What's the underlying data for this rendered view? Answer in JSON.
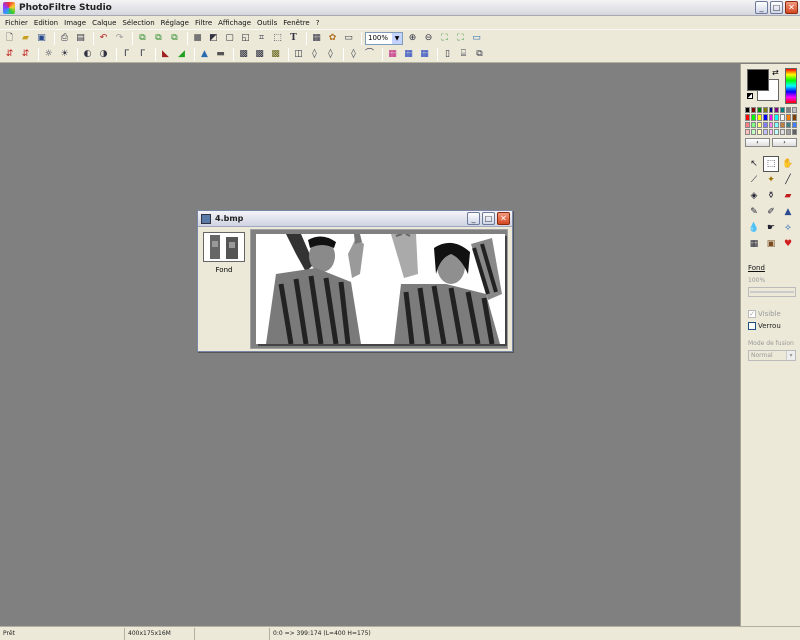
{
  "app": {
    "title": "PhotoFiltre Studio"
  },
  "window_controls": {
    "minimize": "_",
    "maximize": "□",
    "close": "✕"
  },
  "menu": [
    "Fichier",
    "Edition",
    "Image",
    "Calque",
    "Sélection",
    "Réglage",
    "Filtre",
    "Affichage",
    "Outils",
    "Fenêtre",
    "?"
  ],
  "toolbar": {
    "zoom": "100%"
  },
  "document": {
    "title": "4.bmp",
    "layer_name": "Fond"
  },
  "layer_panel": {
    "name": "Fond",
    "opacity": "100%",
    "visible_label": "Visible",
    "lock_label": "Verrou",
    "blend_label": "Mode de fusion",
    "blend_value": "Normal"
  },
  "colors": {
    "foreground": "#000000",
    "background": "#ffffff",
    "palette": [
      "#000000",
      "#800000",
      "#008000",
      "#808000",
      "#000080",
      "#800080",
      "#008080",
      "#808080",
      "#c0c0c0",
      "#ff0000",
      "#00ff00",
      "#ffff00",
      "#0000ff",
      "#ff00ff",
      "#00ffff",
      "#ffffff",
      "#ff8000",
      "#804000",
      "#ff8080",
      "#80ff80",
      "#ffff80",
      "#8080ff",
      "#ff80ff",
      "#80ffff",
      "#c08040",
      "#408080",
      "#4080ff",
      "#ffc0c0",
      "#c0ffc0",
      "#ffffc0",
      "#c0c0ff",
      "#ffc0ff",
      "#c0ffff",
      "#e0e0e0",
      "#a0a0a0",
      "#606060"
    ]
  },
  "status": {
    "state": "Prêt",
    "size": "400x175x16M",
    "selection": "0:0 => 399:174 (L=400  H=175)"
  }
}
